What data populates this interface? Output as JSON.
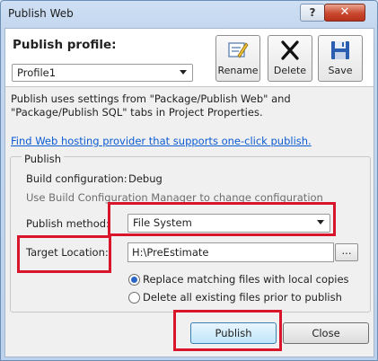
{
  "window": {
    "title": "Publish Web",
    "help_glyph": "?",
    "close_glyph": "✕"
  },
  "profile": {
    "label": "Publish profile:",
    "selected": "Profile1"
  },
  "toolbar": {
    "rename_label": "Rename",
    "delete_label": "Delete",
    "save_label": "Save"
  },
  "description": "Publish uses settings from \"Package/Publish Web\" and \"Package/Publish SQL\" tabs in Project Properties.",
  "hosting_link": "Find Web hosting provider that supports one-click publish.",
  "publish_group": {
    "title": "Publish",
    "build_config_label": "Build configuration:",
    "build_config_value": "Debug",
    "build_config_hint": "Use Build Configuration Manager to change configuration",
    "method_label": "Publish method:",
    "method_value": "File System",
    "target_label": "Target Location:",
    "target_value": "H:\\PreEstimate",
    "browse_label": "...",
    "option_replace": "Replace matching files with local copies",
    "option_delete": "Delete all existing files prior to publish"
  },
  "buttons": {
    "publish": "Publish",
    "close": "Close"
  },
  "colors": {
    "highlight": "#d8152b",
    "link": "#0b5bd3"
  }
}
